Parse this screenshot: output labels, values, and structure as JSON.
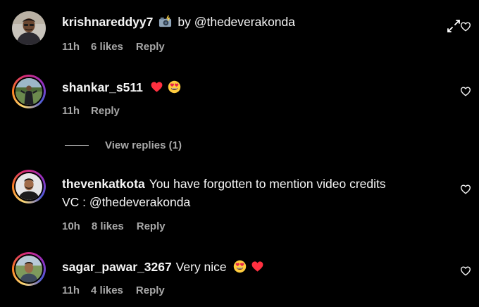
{
  "comments": [
    {
      "username": "krishnareddyy7",
      "text": "by @thedeverakonda",
      "time": "11h",
      "likes": "6 likes",
      "reply": "Reply",
      "avatar": "avatar-man-dark-shirt",
      "emoji_before_text": "camera-flash-emoji"
    },
    {
      "username": "shankar_s511",
      "text": "",
      "time": "11h",
      "reply": "Reply",
      "avatar": "avatar-person-outdoors",
      "emojis": [
        "red-heart-emoji",
        "heart-eyes-emoji"
      ],
      "has_story_ring": true
    },
    {
      "username": "thevenkatkota",
      "text": "You have forgotten to mention video credits",
      "text_line2": "VC : @thedeverakonda",
      "time": "10h",
      "likes": "8 likes",
      "reply": "Reply",
      "avatar": "avatar-bearded-man",
      "has_story_ring": true
    },
    {
      "username": "sagar_pawar_3267",
      "text": "Very nice",
      "time": "11h",
      "likes": "4 likes",
      "reply": "Reply",
      "avatar": "avatar-man-outdoors",
      "emojis": [
        "heart-eyes-emoji",
        "red-heart-emoji"
      ],
      "has_story_ring": true
    }
  ],
  "view_replies": "View replies (1)",
  "icons": {
    "like": "heart-outline-icon",
    "expand": "expand-arrows-icon"
  },
  "colors": {
    "background": "#000000",
    "text": "#f5f5f5",
    "secondary_text": "#a8a8a8",
    "heart_red": "#ff3040"
  }
}
